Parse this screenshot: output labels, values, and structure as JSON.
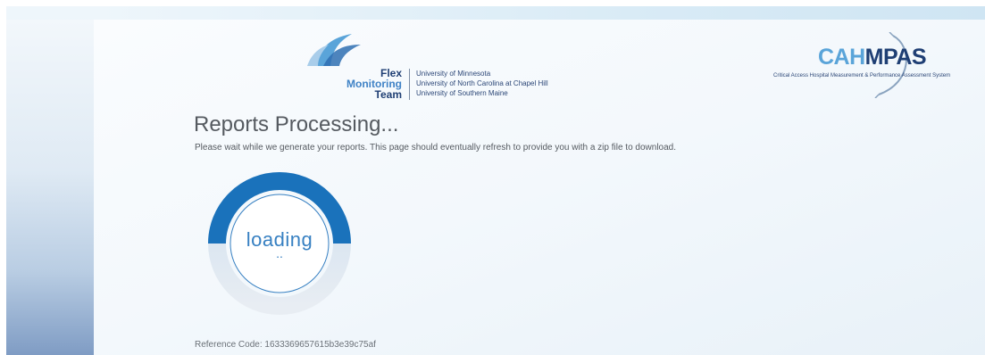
{
  "header": {
    "fmt_logo": {
      "words": [
        "Flex",
        "Monitoring",
        "Team"
      ],
      "universities": [
        "University of Minnesota",
        "University of North Carolina at Chapel Hill",
        "University of Southern Maine"
      ]
    },
    "cahmpas_logo": {
      "title_part1": "CAH",
      "title_part2": "MPAS",
      "subtitle": "Critical Access Hospital Measurement & Performance Assessment System"
    }
  },
  "main": {
    "heading": "Reports Processing...",
    "message": "Please wait while we generate your reports. This page should eventually refresh to provide you with a zip file to download.",
    "spinner": {
      "label": "loading",
      "dots": "..",
      "arc_color": "#1a72bb",
      "track_color": "#dfe6ee"
    },
    "reference_code": "Reference Code: 1633369657615b3e39c75af"
  },
  "colors": {
    "accent": "#3780c2",
    "navy": "#1f3f74",
    "text": "#555a60"
  }
}
